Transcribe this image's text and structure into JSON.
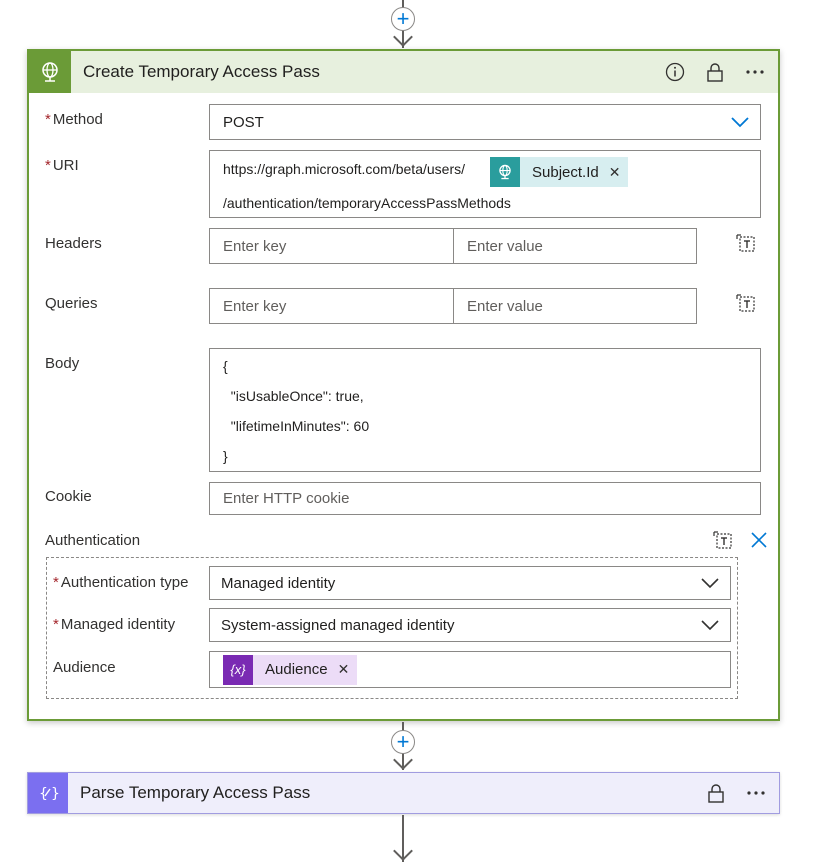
{
  "action": {
    "title": "Create Temporary Access Pass",
    "fields": {
      "method": {
        "label": "Method",
        "value": "POST"
      },
      "uri": {
        "label": "URI",
        "prefix": "https://graph.microsoft.com/beta/users/",
        "token": "Subject.Id",
        "suffix": "/authentication/temporaryAccessPassMethods"
      },
      "headers": {
        "label": "Headers",
        "key_placeholder": "Enter key",
        "value_placeholder": "Enter value"
      },
      "queries": {
        "label": "Queries",
        "key_placeholder": "Enter key",
        "value_placeholder": "Enter value"
      },
      "body": {
        "label": "Body",
        "lines": [
          "{",
          "  \"isUsableOnce\": true,",
          "  \"lifetimeInMinutes\": 60",
          "}"
        ]
      },
      "cookie": {
        "label": "Cookie",
        "placeholder": "Enter HTTP cookie"
      },
      "authentication": {
        "label": "Authentication",
        "type": {
          "label": "Authentication type",
          "value": "Managed identity"
        },
        "identity": {
          "label": "Managed identity",
          "value": "System-assigned managed identity"
        },
        "audience": {
          "label": "Audience",
          "token": "Audience",
          "token_icon": "{x}"
        }
      }
    }
  },
  "next_action": {
    "title": "Parse Temporary Access Pass"
  },
  "icons": {
    "header": "globe-network-icon",
    "info": "info-icon",
    "lock": "lock-icon",
    "more": "more-icon",
    "text_mode": "text-mode-icon",
    "close": "close-icon",
    "chevron": "chevron-down-icon",
    "add": "plus-icon",
    "parse": "parse-json-icon"
  },
  "colors": {
    "http_accent": "#6b9b37",
    "http_header_bg": "#e7f0de",
    "token_teal": "#2a9d9d",
    "token_teal_bg": "#d7eef0",
    "variable_purple": "#7a2ab3",
    "variable_bg": "#ecdcf7",
    "parse_accent": "#7b6ff0",
    "link_blue": "#0078d4"
  }
}
